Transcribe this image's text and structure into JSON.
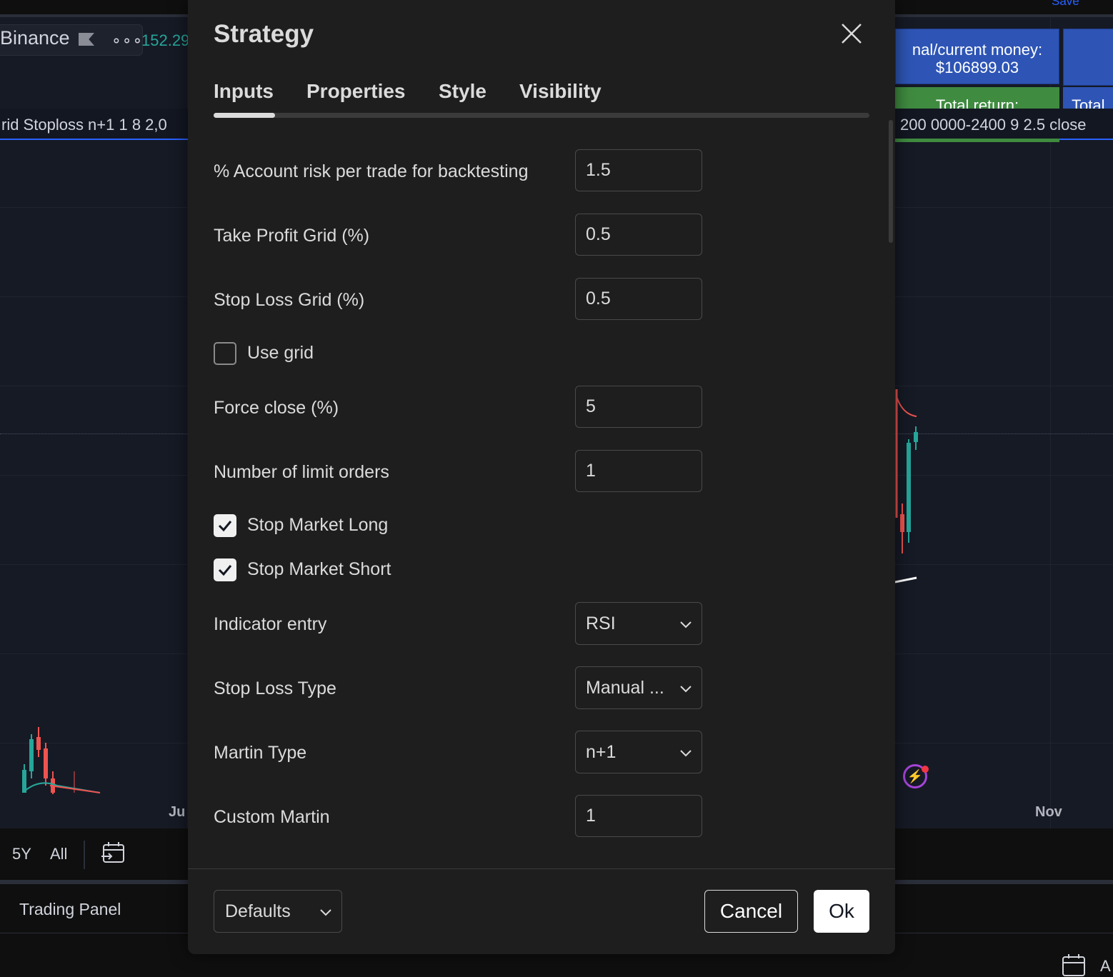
{
  "background": {
    "top_save": "Save",
    "symbol": "Binance",
    "price": "152.29",
    "legend_left": "rid Stoploss n+1 1 8 2,0",
    "legend_right": "200 0000-2400 9 2.5 close",
    "money_label": "nal/current money:",
    "money_value": "$106899.03",
    "total_return_label": "Total return:",
    "total_return_label2": "Total",
    "x_labels": [
      "Ju",
      "Nov"
    ],
    "ranges": [
      "5Y",
      "All"
    ],
    "trading_panel": "Trading Panel",
    "corner_text": "A"
  },
  "dialog": {
    "title": "Strategy",
    "tabs": [
      "Inputs",
      "Properties",
      "Style",
      "Visibility"
    ],
    "active_tab": "Inputs",
    "inputs": {
      "account_risk": {
        "label": "% Account risk per trade for backtesting",
        "value": "1.5"
      },
      "take_profit_grid": {
        "label": "Take Profit Grid (%)",
        "value": "0.5"
      },
      "stop_loss_grid": {
        "label": "Stop Loss Grid (%)",
        "value": "0.5"
      },
      "use_grid": {
        "label": "Use grid",
        "checked": false
      },
      "force_close": {
        "label": "Force close (%)",
        "value": "5"
      },
      "limit_orders": {
        "label": "Number of limit orders",
        "value": "1"
      },
      "stop_market_long": {
        "label": "Stop Market Long",
        "checked": true
      },
      "stop_market_short": {
        "label": "Stop Market Short",
        "checked": true
      },
      "indicator_entry": {
        "label": "Indicator entry",
        "value": "RSI"
      },
      "stop_loss_type": {
        "label": "Stop Loss Type",
        "value": "Manual ..."
      },
      "martin_type": {
        "label": "Martin Type",
        "value": "n+1"
      },
      "custom_martin": {
        "label": "Custom Martin",
        "value": "1"
      }
    },
    "footer": {
      "defaults": "Defaults",
      "cancel": "Cancel",
      "ok": "Ok"
    }
  },
  "colors": {
    "dialog_bg": "#1e1e1e",
    "chart_bg": "#161a25",
    "accent_blue": "#2962ff",
    "up_green": "#26a69a",
    "down_red": "#ef5350"
  }
}
